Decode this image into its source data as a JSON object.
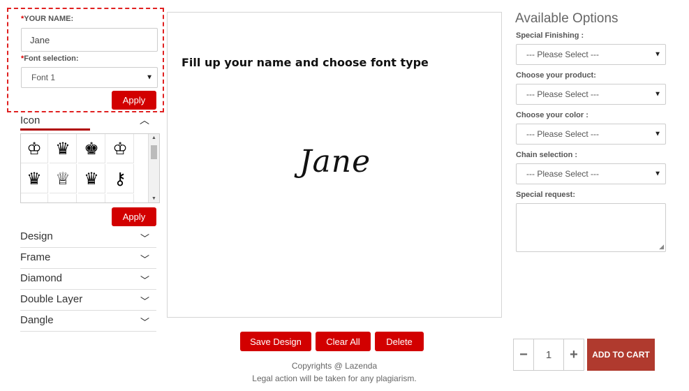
{
  "name_section": {
    "name_label_req": "*",
    "name_label": "YOUR NAME:",
    "name_value": "Jane",
    "font_label_req": "*",
    "font_label": "Font selection:",
    "font_value": "Font 1",
    "apply_label": "Apply"
  },
  "icon_section": {
    "title": "Icon",
    "apply_label": "Apply",
    "icons": [
      {
        "name": "crown-icon-1",
        "glyph": "♔"
      },
      {
        "name": "crown-icon-2",
        "glyph": "♛"
      },
      {
        "name": "crown-icon-3",
        "glyph": "♚"
      },
      {
        "name": "crown-icon-4",
        "glyph": "♔"
      },
      {
        "name": "crown-icon-5",
        "glyph": "♛"
      },
      {
        "name": "crown-icon-6",
        "glyph": "♕"
      },
      {
        "name": "crown-icon-7",
        "glyph": "♛"
      },
      {
        "name": "key-icon",
        "glyph": "⚷"
      }
    ]
  },
  "accordion": [
    {
      "label": "Design"
    },
    {
      "label": "Frame"
    },
    {
      "label": "Diamond"
    },
    {
      "label": "Double Layer"
    },
    {
      "label": "Dangle"
    }
  ],
  "canvas": {
    "instruction": "Fill up your name and choose font type",
    "preview_name": "Jane"
  },
  "actions": {
    "save": "Save Design",
    "clear": "Clear All",
    "delete": "Delete"
  },
  "footer": {
    "line1": "Copyrights @ Lazenda",
    "line2": "Legal action will be taken for any plagiarism."
  },
  "options": {
    "title": "Available Options",
    "finishing_label": "Special Finishing :",
    "finishing_value": "--- Please Select ---",
    "product_label": "Choose your product:",
    "product_value": "--- Please Select ---",
    "color_label": "Choose your color :",
    "color_value": "--- Please Select ---",
    "chain_label": "Chain selection :",
    "chain_value": "--- Please Select ---",
    "request_label": "Special request:"
  },
  "cart": {
    "minus": "−",
    "quantity": "1",
    "plus": "+",
    "add_label": "ADD TO CART"
  },
  "colors": {
    "accent_red": "#d20000",
    "cart_red": "#b03a2e",
    "highlight_border": "#e02020"
  }
}
